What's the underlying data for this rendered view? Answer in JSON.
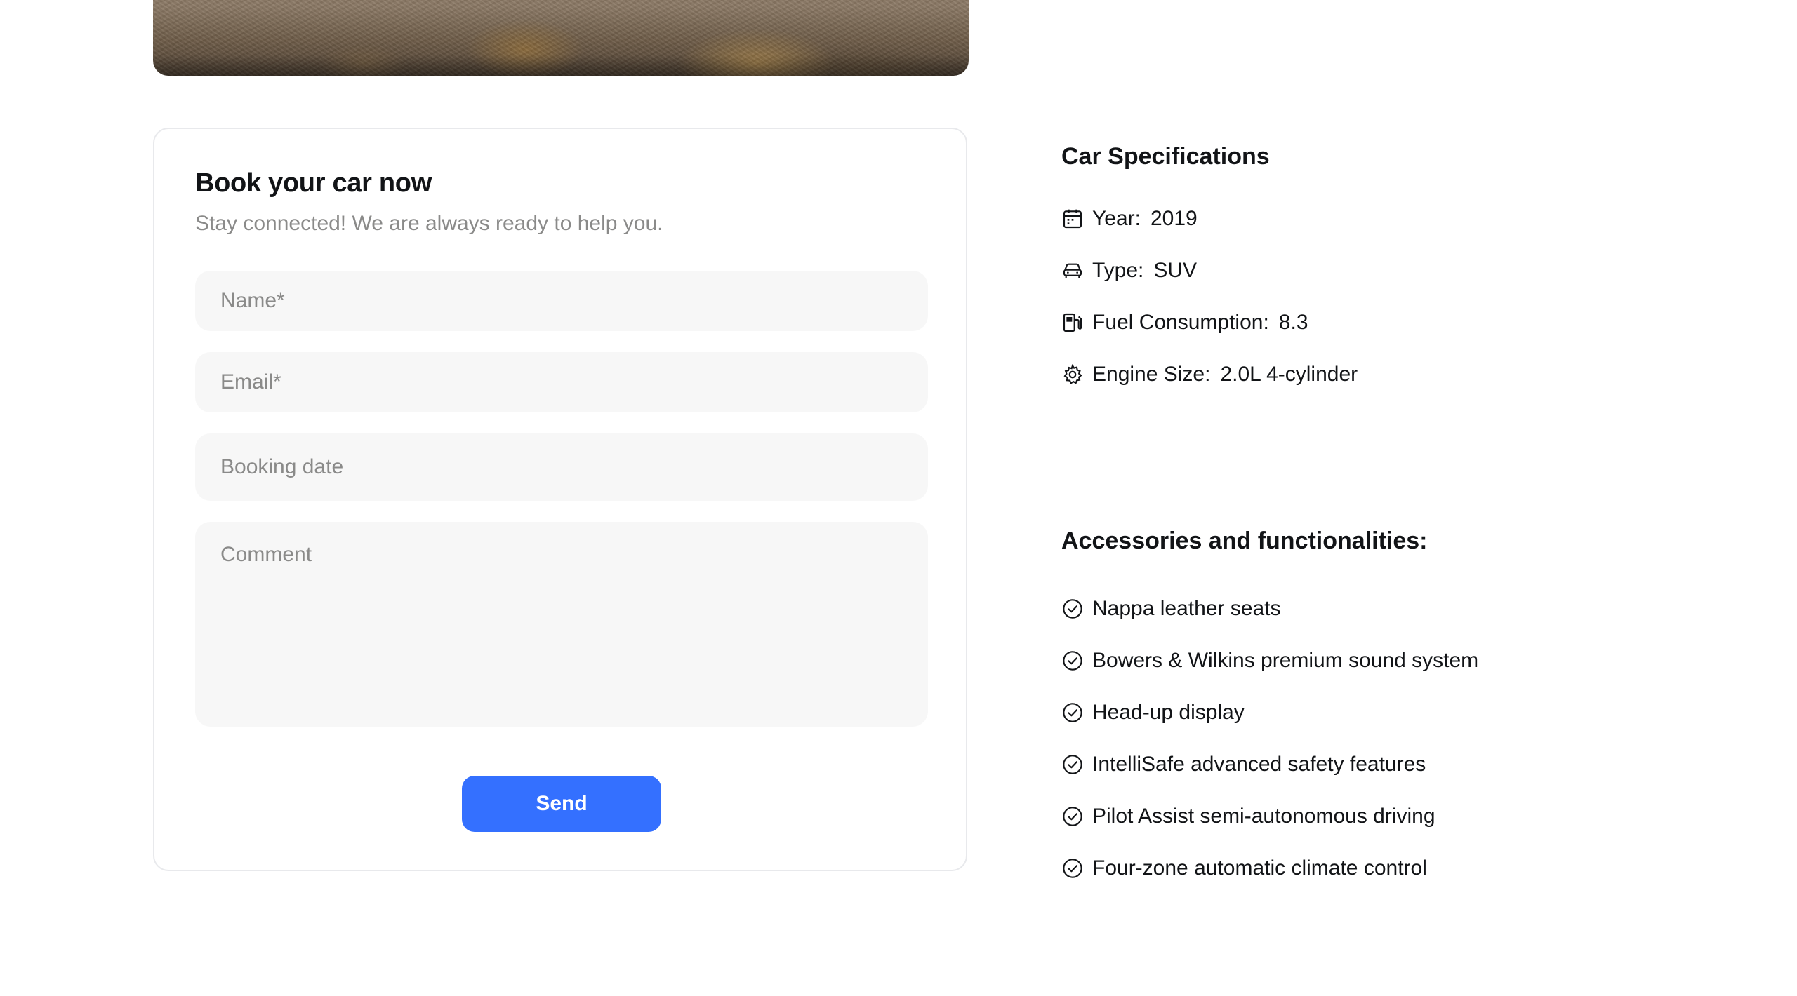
{
  "booking": {
    "title": "Book your car now",
    "subtitle": "Stay connected! We are always ready to help you.",
    "fields": {
      "name_placeholder": "Name*",
      "email_placeholder": "Email*",
      "date_placeholder": "Booking date",
      "comment_placeholder": "Comment"
    },
    "send_label": "Send",
    "accent_color": "#3470ff"
  },
  "specs": {
    "title": "Car Specifications",
    "items": [
      {
        "icon": "calendar-icon",
        "label": "Year:",
        "value": "2019"
      },
      {
        "icon": "car-icon",
        "label": "Type:",
        "value": "SUV"
      },
      {
        "icon": "fuel-pump-icon",
        "label": "Fuel Consumption:",
        "value": "8.3"
      },
      {
        "icon": "gear-icon",
        "label": "Engine Size:",
        "value": "2.0L 4-cylinder"
      }
    ]
  },
  "accessories": {
    "title": "Accessories and functionalities:",
    "items": [
      {
        "icon": "check-circle-icon",
        "text": "Nappa leather seats"
      },
      {
        "icon": "check-circle-icon",
        "text": "Bowers & Wilkins premium sound system"
      },
      {
        "icon": "check-circle-icon",
        "text": "Head-up display"
      },
      {
        "icon": "check-circle-icon",
        "text": "IntelliSafe advanced safety features"
      },
      {
        "icon": "check-circle-icon",
        "text": "Pilot Assist semi-autonomous driving"
      },
      {
        "icon": "check-circle-icon",
        "text": "Four-zone automatic climate control"
      }
    ]
  }
}
